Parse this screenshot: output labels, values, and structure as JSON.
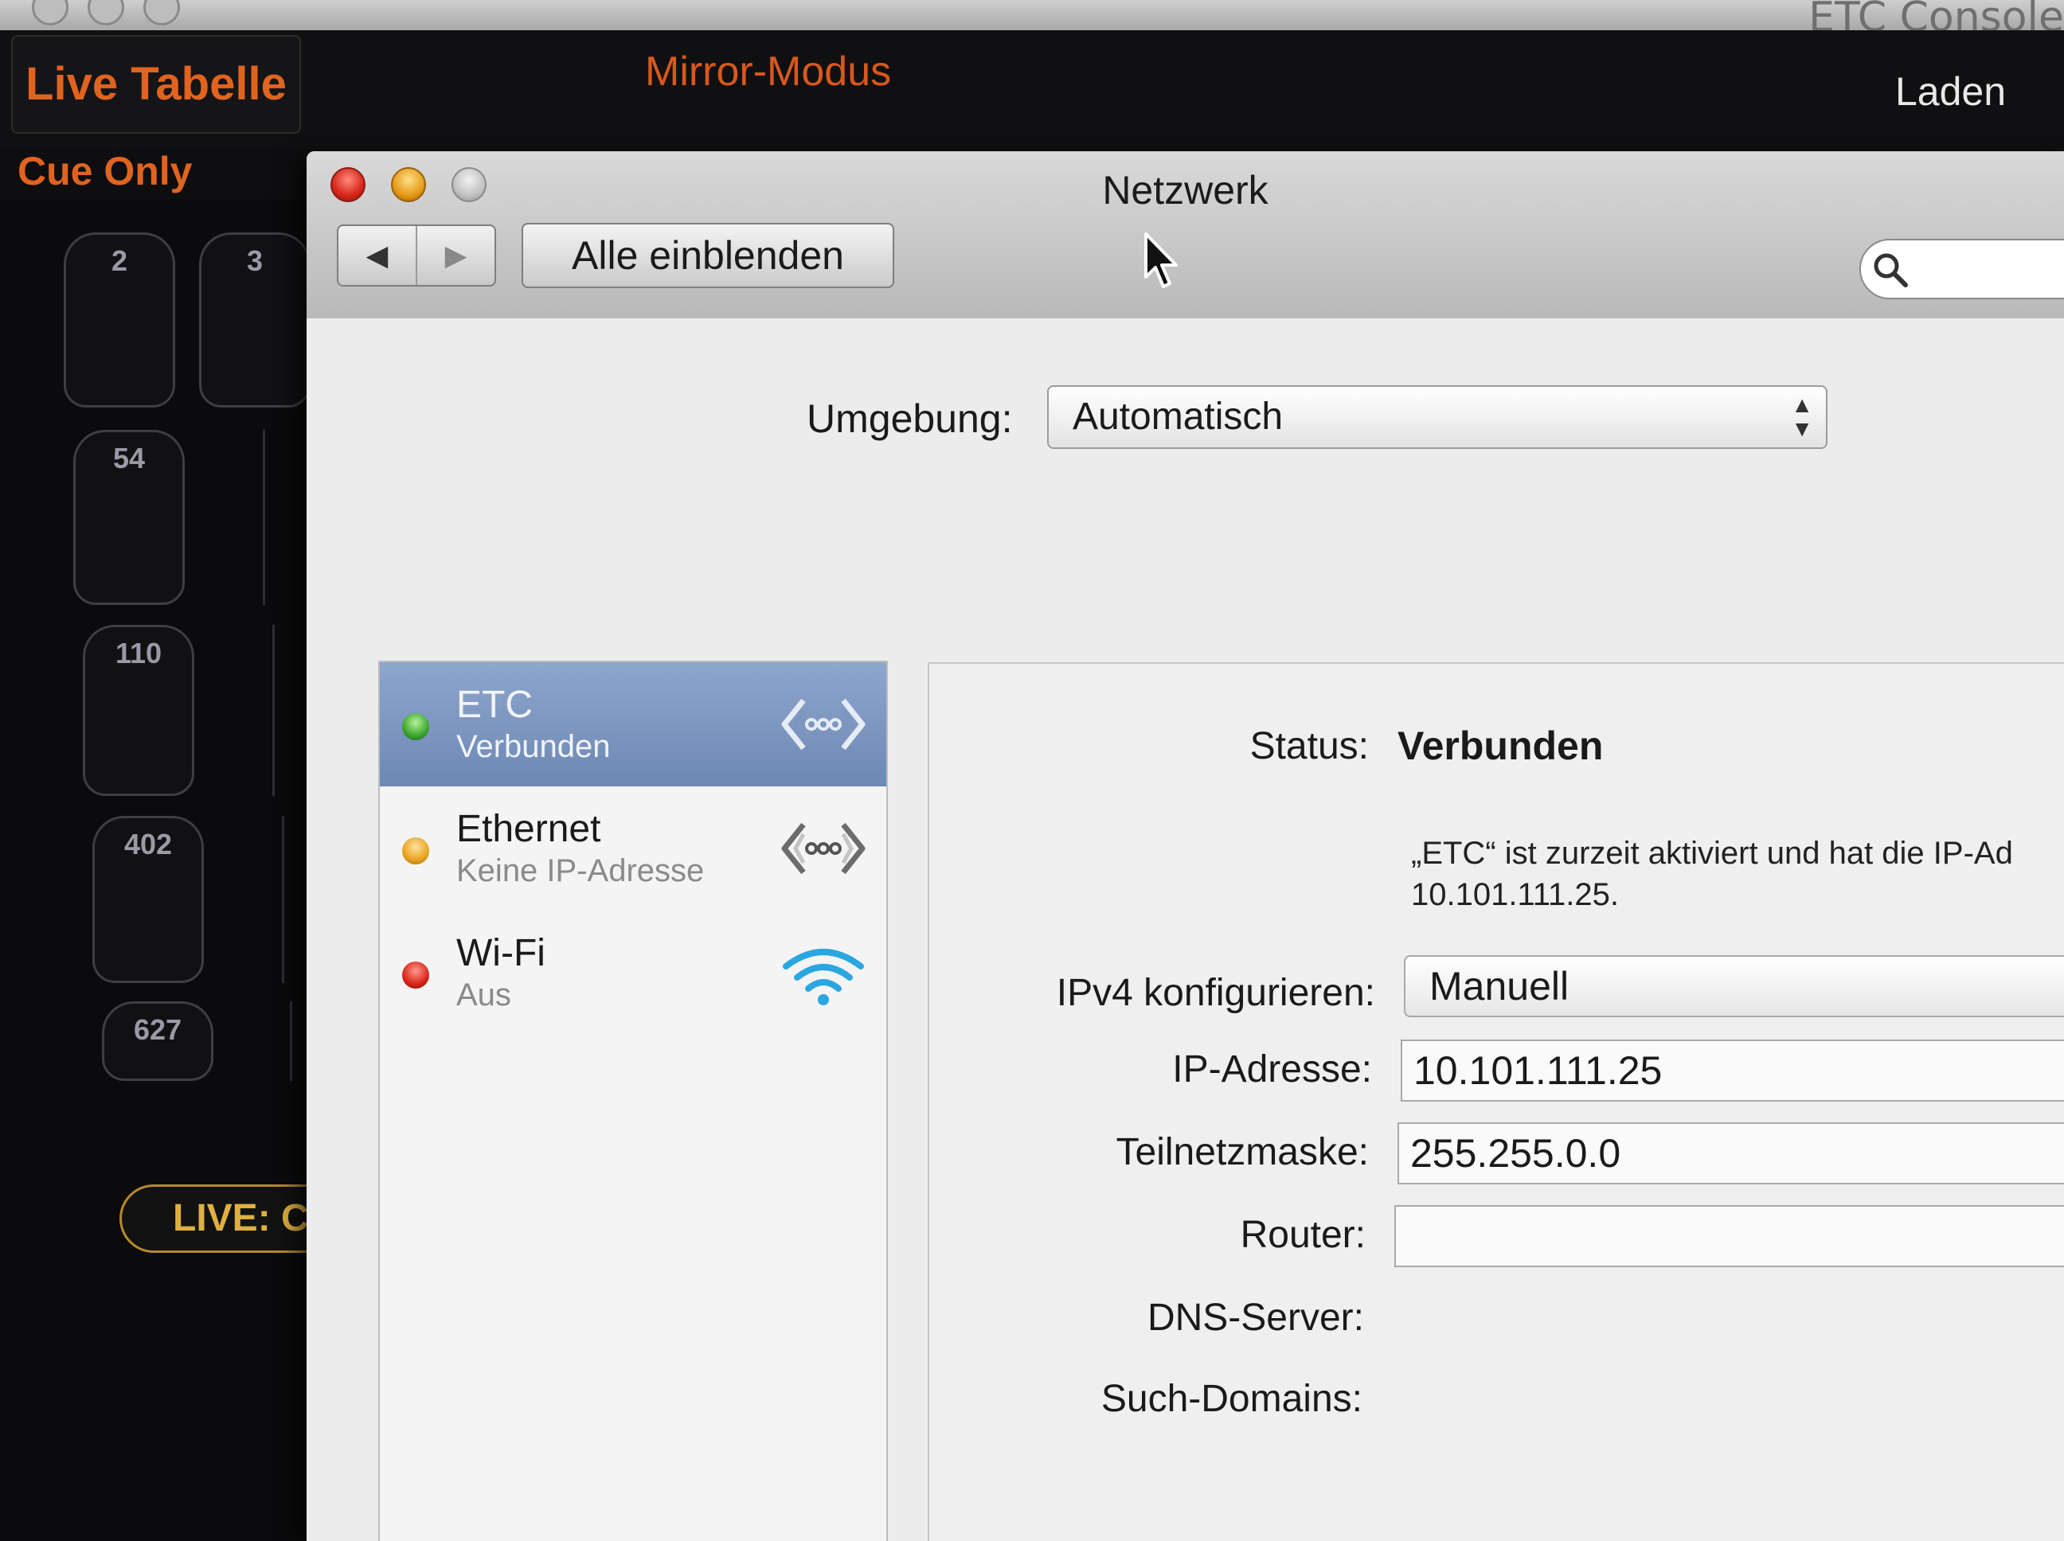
{
  "etc": {
    "window_title": "ETC Console",
    "tab_live": "Live Tabelle",
    "mirror_mode": "Mirror-Modus",
    "load": "Laden",
    "cue_only": "Cue Only",
    "cues": [
      "2",
      "3",
      "54",
      "110",
      "402",
      "627"
    ],
    "live_cue": "LIVE: Cue"
  },
  "network": {
    "title": "Netzwerk",
    "show_all": "Alle einblenden",
    "back_glyph": "◀",
    "forward_glyph": "▶",
    "search_icon": "magnifier",
    "location": {
      "label": "Umgebung:",
      "value": "Automatisch"
    },
    "services": [
      {
        "name": "ETC",
        "status": "Verbunden",
        "status_color": "#3aa52b",
        "icon": "ethernet-arrows-icon",
        "selected": true
      },
      {
        "name": "Ethernet",
        "status": "Keine IP-Adresse",
        "status_color": "#e8a21f",
        "icon": "ethernet-arrows-icon",
        "selected": false
      },
      {
        "name": "Wi-Fi",
        "status": "Aus",
        "status_color": "#d92418",
        "icon": "wifi-icon",
        "selected": false
      }
    ],
    "detail": {
      "status_label": "Status:",
      "status_value": "Verbunden",
      "description_line1": "„ETC“ ist zurzeit aktiviert und hat die IP-Ad",
      "description_line2": "10.101.111.25.",
      "ipv4_label": "IPv4 konfigurieren:",
      "ipv4_value": "Manuell",
      "ip_label": "IP-Adresse:",
      "ip_value": "10.101.111.25",
      "subnet_label": "Teilnetzmaske:",
      "subnet_value": "255.255.0.0",
      "router_label": "Router:",
      "router_value": "",
      "dns_label": "DNS-Server:",
      "search_domains_label": "Such-Domains:"
    }
  }
}
